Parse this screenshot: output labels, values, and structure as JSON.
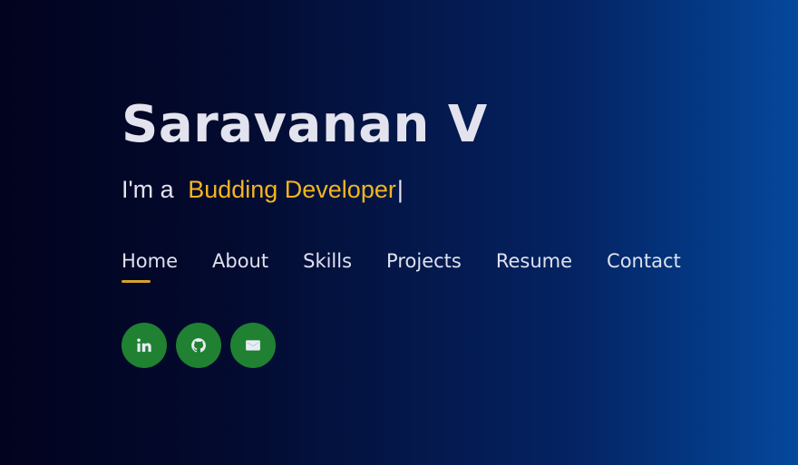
{
  "hero": {
    "name": "Saravanan V",
    "tagline_prefix": "I'm a",
    "role": "Budding Developer",
    "cursor": "|"
  },
  "nav": {
    "items": [
      {
        "label": "Home",
        "active": true
      },
      {
        "label": "About"
      },
      {
        "label": "Skills"
      },
      {
        "label": "Projects"
      },
      {
        "label": "Resume"
      },
      {
        "label": "Contact"
      }
    ]
  },
  "socials": [
    {
      "icon": "linkedin-icon"
    },
    {
      "icon": "github-icon"
    },
    {
      "icon": "mail-icon"
    }
  ],
  "colors": {
    "accent": "#f2b51e",
    "nav_underline": "#d9a12a",
    "social_bg": "#1f8131",
    "text": "#e2e3ee"
  }
}
